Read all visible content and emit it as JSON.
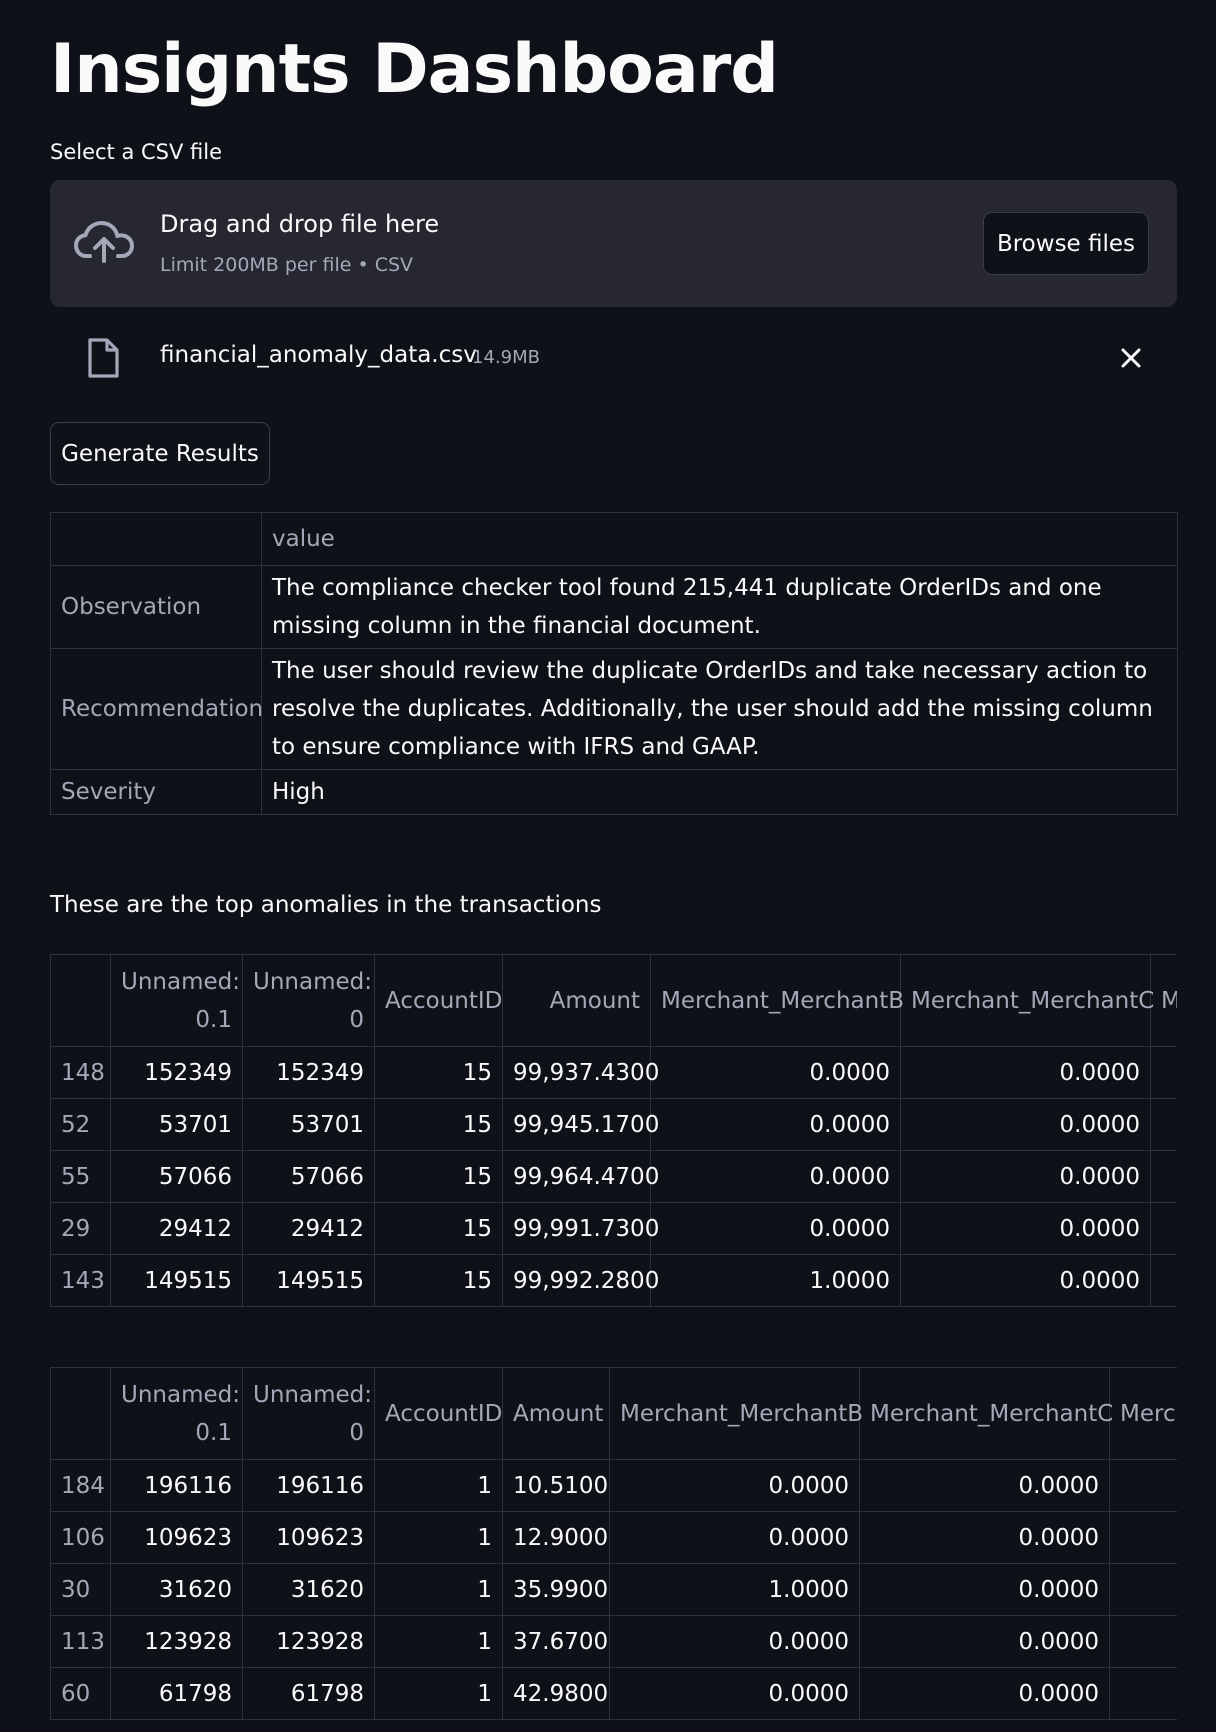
{
  "page": {
    "title": "Insignts Dashboard"
  },
  "uploader": {
    "label": "Select a CSV file",
    "drop_text": "Drag and drop file here",
    "limit_text": "Limit 200MB per file • CSV",
    "browse_label": "Browse files",
    "file": {
      "name": "financial_anomaly_data.csv",
      "size": "14.9MB"
    }
  },
  "actions": {
    "generate_label": "Generate Results"
  },
  "results": {
    "header": "value",
    "rows": [
      {
        "label": "Observation",
        "value": "The compliance checker tool found 215,441 duplicate OrderIDs and one missing column in the financial document."
      },
      {
        "label": "Recommendation",
        "value": "The user should review the duplicate OrderIDs and take necessary action to resolve the duplicates. Additionally, the user should add the missing column to ensure compliance with IFRS and GAAP."
      },
      {
        "label": "Severity",
        "value": "High"
      }
    ]
  },
  "anomalies": {
    "caption": "These are the top anomalies in the transactions",
    "columns": [
      "",
      "Unnamed: 0.1",
      "Unnamed: 0",
      "AccountID",
      "Amount",
      "Merchant_MerchantB",
      "Merchant_MerchantC",
      "Merchant_MerchantD"
    ],
    "top_table": [
      [
        "148",
        "152349",
        "152349",
        "15",
        "99,937.4300",
        "0.0000",
        "0.0000",
        ""
      ],
      [
        "52",
        "53701",
        "53701",
        "15",
        "99,945.1700",
        "0.0000",
        "0.0000",
        ""
      ],
      [
        "55",
        "57066",
        "57066",
        "15",
        "99,964.4700",
        "0.0000",
        "0.0000",
        ""
      ],
      [
        "29",
        "29412",
        "29412",
        "15",
        "99,991.7300",
        "0.0000",
        "0.0000",
        ""
      ],
      [
        "143",
        "149515",
        "149515",
        "15",
        "99,992.2800",
        "1.0000",
        "0.0000",
        ""
      ]
    ],
    "bottom_table": [
      [
        "184",
        "196116",
        "196116",
        "1",
        "10.5100",
        "0.0000",
        "0.0000",
        ""
      ],
      [
        "106",
        "109623",
        "109623",
        "1",
        "12.9000",
        "0.0000",
        "0.0000",
        ""
      ],
      [
        "30",
        "31620",
        "31620",
        "1",
        "35.9900",
        "1.0000",
        "0.0000",
        ""
      ],
      [
        "113",
        "123928",
        "123928",
        "1",
        "37.6700",
        "0.0000",
        "0.0000",
        ""
      ],
      [
        "60",
        "61798",
        "61798",
        "1",
        "42.9800",
        "0.0000",
        "0.0000",
        ""
      ]
    ]
  },
  "colors": {
    "background": "#0e1117",
    "surface": "#262730",
    "text": "#fafafa",
    "muted_text": "#a3a8b8",
    "border": "#2f323c"
  },
  "icons": {
    "upload": "cloud-upload-icon",
    "file": "file-icon",
    "remove": "close-icon"
  }
}
